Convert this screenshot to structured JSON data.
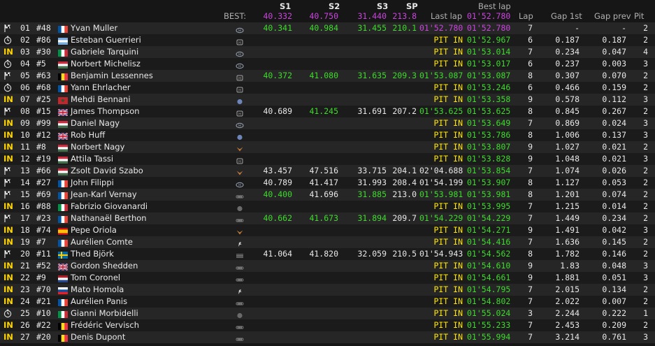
{
  "colors": {
    "background": "#161616",
    "row_odd": "#262626",
    "row_even": "#1b1b1b",
    "green": "#3ddc2a",
    "purple": "#cc44e0",
    "yellow": "#ffe600",
    "in_status": "#ffd400"
  },
  "header": {
    "best_label": "BEST:",
    "s1": "S1",
    "s2": "S2",
    "s3": "S3",
    "sp": "SP",
    "best_lap_label": "Best lap",
    "best_s1": "40.332",
    "best_s2": "40.750",
    "best_s3": "31.440",
    "best_sp": "213.8",
    "best_lap": "01'52.780",
    "last_lap": "Last lap",
    "lap": "Lap",
    "gap_1st": "Gap 1st",
    "gap_prev": "Gap prev",
    "pit": "Pit"
  },
  "rows": [
    {
      "status": "flag",
      "pos": "01",
      "num": "#48",
      "flag": "fr",
      "driver": "Yvan Muller",
      "car": "hyundai",
      "s1": "40.341",
      "s1c": "green",
      "s2": "40.984",
      "s2c": "green",
      "s3": "31.455",
      "s3c": "green",
      "sp": "210.1",
      "spc": "green",
      "last": "01'52.780",
      "lastc": "purple",
      "best": "01'52.780",
      "bestc": "purple",
      "lap": "7",
      "gap1": "-",
      "gapp": "-",
      "pit": "2"
    },
    {
      "status": "clock",
      "pos": "02",
      "num": "#86",
      "flag": "ar",
      "driver": "Esteban Guerrieri",
      "car": "honda",
      "s1": "",
      "s1c": "",
      "s2": "",
      "s2c": "",
      "s3": "",
      "s3c": "",
      "sp": "",
      "spc": "",
      "last": "PIT IN",
      "lastc": "yellow",
      "best": "01'52.967",
      "bestc": "green",
      "lap": "6",
      "gap1": "0.187",
      "gapp": "0.187",
      "pit": "2"
    },
    {
      "status": "IN",
      "pos": "03",
      "num": "#30",
      "flag": "it",
      "driver": "Gabriele Tarquini",
      "car": "hyundai",
      "s1": "",
      "s1c": "",
      "s2": "",
      "s2c": "",
      "s3": "",
      "s3c": "",
      "sp": "",
      "spc": "",
      "last": "PIT IN",
      "lastc": "yellow",
      "best": "01'53.014",
      "bestc": "green",
      "lap": "7",
      "gap1": "0.234",
      "gapp": "0.047",
      "pit": "4"
    },
    {
      "status": "clock",
      "pos": "04",
      "num": "#5",
      "flag": "hu",
      "driver": "Norbert Michelisz",
      "car": "hyundai",
      "s1": "",
      "s1c": "",
      "s2": "",
      "s2c": "",
      "s3": "",
      "s3c": "",
      "sp": "",
      "spc": "",
      "last": "PIT IN",
      "lastc": "yellow",
      "best": "01'53.017",
      "bestc": "green",
      "lap": "6",
      "gap1": "0.237",
      "gapp": "0.003",
      "pit": "3"
    },
    {
      "status": "flag",
      "pos": "05",
      "num": "#63",
      "flag": "be",
      "driver": "Benjamin Lessennes",
      "car": "honda",
      "s1": "40.372",
      "s1c": "green",
      "s2": "41.080",
      "s2c": "green",
      "s3": "31.635",
      "s3c": "green",
      "sp": "209.3",
      "spc": "green",
      "last": "01'53.087",
      "lastc": "green",
      "best": "01'53.087",
      "bestc": "green",
      "lap": "8",
      "gap1": "0.307",
      "gapp": "0.070",
      "pit": "2"
    },
    {
      "status": "clock",
      "pos": "06",
      "num": "#68",
      "flag": "fr",
      "driver": "Yann Ehrlacher",
      "car": "honda",
      "s1": "",
      "s1c": "",
      "s2": "",
      "s2c": "",
      "s3": "",
      "s3c": "",
      "sp": "",
      "spc": "",
      "last": "PIT IN",
      "lastc": "yellow",
      "best": "01'53.246",
      "bestc": "green",
      "lap": "6",
      "gap1": "0.466",
      "gapp": "0.159",
      "pit": "2"
    },
    {
      "status": "IN",
      "pos": "07",
      "num": "#25",
      "flag": "ma",
      "driver": "Mehdi Bennani",
      "car": "vw",
      "s1": "",
      "s1c": "",
      "s2": "",
      "s2c": "",
      "s3": "",
      "s3c": "",
      "sp": "",
      "spc": "",
      "last": "PIT IN",
      "lastc": "yellow",
      "best": "01'53.358",
      "bestc": "green",
      "lap": "9",
      "gap1": "0.578",
      "gapp": "0.112",
      "pit": "3"
    },
    {
      "status": "flag",
      "pos": "08",
      "num": "#15",
      "flag": "gb",
      "driver": "James Thompson",
      "car": "honda",
      "s1": "40.689",
      "s1c": "white",
      "s2": "41.245",
      "s2c": "green",
      "s3": "31.691",
      "s3c": "white",
      "sp": "207.2",
      "spc": "white",
      "last": "01'53.625",
      "lastc": "green",
      "best": "01'53.625",
      "bestc": "green",
      "lap": "8",
      "gap1": "0.845",
      "gapp": "0.267",
      "pit": "2"
    },
    {
      "status": "IN",
      "pos": "09",
      "num": "#99",
      "flag": "hu",
      "driver": "Daniel Nagy",
      "car": "hyundai",
      "s1": "",
      "s1c": "",
      "s2": "",
      "s2c": "",
      "s3": "",
      "s3c": "",
      "sp": "",
      "spc": "",
      "last": "PIT IN",
      "lastc": "yellow",
      "best": "01'53.649",
      "bestc": "green",
      "lap": "7",
      "gap1": "0.869",
      "gapp": "0.024",
      "pit": "3"
    },
    {
      "status": "IN",
      "pos": "10",
      "num": "#12",
      "flag": "gb",
      "driver": "Rob Huff",
      "car": "vw",
      "s1": "",
      "s1c": "",
      "s2": "",
      "s2c": "",
      "s3": "",
      "s3c": "",
      "sp": "",
      "spc": "",
      "last": "PIT IN",
      "lastc": "yellow",
      "best": "01'53.786",
      "bestc": "green",
      "lap": "8",
      "gap1": "1.006",
      "gapp": "0.137",
      "pit": "3"
    },
    {
      "status": "IN",
      "pos": "11",
      "num": "#8",
      "flag": "hu",
      "driver": "Norbert Nagy",
      "car": "cupra",
      "s1": "",
      "s1c": "",
      "s2": "",
      "s2c": "",
      "s3": "",
      "s3c": "",
      "sp": "",
      "spc": "",
      "last": "PIT IN",
      "lastc": "yellow",
      "best": "01'53.807",
      "bestc": "green",
      "lap": "9",
      "gap1": "1.027",
      "gapp": "0.021",
      "pit": "2"
    },
    {
      "status": "IN",
      "pos": "12",
      "num": "#19",
      "flag": "hu",
      "driver": "Attila Tassi",
      "car": "honda",
      "s1": "",
      "s1c": "",
      "s2": "",
      "s2c": "",
      "s3": "",
      "s3c": "",
      "sp": "",
      "spc": "",
      "last": "PIT IN",
      "lastc": "yellow",
      "best": "01'53.828",
      "bestc": "green",
      "lap": "9",
      "gap1": "1.048",
      "gapp": "0.021",
      "pit": "3"
    },
    {
      "status": "flag",
      "pos": "13",
      "num": "#66",
      "flag": "hu",
      "driver": "Zsolt David Szabo",
      "car": "cupra",
      "s1": "43.457",
      "s1c": "white",
      "s2": "47.516",
      "s2c": "white",
      "s3": "33.715",
      "s3c": "white",
      "sp": "204.1",
      "spc": "white",
      "last": "02'04.688",
      "lastc": "white",
      "best": "01'53.854",
      "bestc": "green",
      "lap": "7",
      "gap1": "1.074",
      "gapp": "0.026",
      "pit": "2"
    },
    {
      "status": "flag",
      "pos": "14",
      "num": "#27",
      "flag": "fr",
      "driver": "John Filippi",
      "car": "hyundai",
      "s1": "40.789",
      "s1c": "white",
      "s2": "41.417",
      "s2c": "white",
      "s3": "31.993",
      "s3c": "white",
      "sp": "208.4",
      "spc": "white",
      "last": "01'54.199",
      "lastc": "white",
      "best": "01'53.907",
      "bestc": "green",
      "lap": "8",
      "gap1": "1.127",
      "gapp": "0.053",
      "pit": "2"
    },
    {
      "status": "flag",
      "pos": "15",
      "num": "#69",
      "flag": "fr",
      "driver": "Jean-Karl Vernay",
      "car": "audi",
      "s1": "40.400",
      "s1c": "green",
      "s2": "41.696",
      "s2c": "white",
      "s3": "31.885",
      "s3c": "green",
      "sp": "213.0",
      "spc": "white",
      "last": "01'53.981",
      "lastc": "green",
      "best": "01'53.981",
      "bestc": "green",
      "lap": "8",
      "gap1": "1.201",
      "gapp": "0.074",
      "pit": "2"
    },
    {
      "status": "IN",
      "pos": "16",
      "num": "#88",
      "flag": "it",
      "driver": "Fabrizio Giovanardi",
      "car": "alfa",
      "s1": "",
      "s1c": "",
      "s2": "",
      "s2c": "",
      "s3": "",
      "s3c": "",
      "sp": "",
      "spc": "",
      "last": "PIT IN",
      "lastc": "yellow",
      "best": "01'53.995",
      "bestc": "green",
      "lap": "7",
      "gap1": "1.215",
      "gapp": "0.014",
      "pit": "2"
    },
    {
      "status": "flag",
      "pos": "17",
      "num": "#23",
      "flag": "fr",
      "driver": "Nathanaël Berthon",
      "car": "audi",
      "s1": "40.662",
      "s1c": "green",
      "s2": "41.673",
      "s2c": "green",
      "s3": "31.894",
      "s3c": "green",
      "sp": "209.7",
      "spc": "white",
      "last": "01'54.229",
      "lastc": "green",
      "best": "01'54.229",
      "bestc": "green",
      "lap": "7",
      "gap1": "1.449",
      "gapp": "0.234",
      "pit": "2"
    },
    {
      "status": "IN",
      "pos": "18",
      "num": "#74",
      "flag": "es",
      "driver": "Pepe Oriola",
      "car": "cupra",
      "s1": "",
      "s1c": "",
      "s2": "",
      "s2c": "",
      "s3": "",
      "s3c": "",
      "sp": "",
      "spc": "",
      "last": "PIT IN",
      "lastc": "yellow",
      "best": "01'54.271",
      "bestc": "green",
      "lap": "9",
      "gap1": "1.491",
      "gapp": "0.042",
      "pit": "3"
    },
    {
      "status": "IN",
      "pos": "19",
      "num": "#7",
      "flag": "fr",
      "driver": "Aurélien Comte",
      "car": "peugeot",
      "s1": "",
      "s1c": "",
      "s2": "",
      "s2c": "",
      "s3": "",
      "s3c": "",
      "sp": "",
      "spc": "",
      "last": "PIT IN",
      "lastc": "yellow",
      "best": "01'54.416",
      "bestc": "green",
      "lap": "7",
      "gap1": "1.636",
      "gapp": "0.145",
      "pit": "2"
    },
    {
      "status": "flag",
      "pos": "20",
      "num": "#11",
      "flag": "se",
      "driver": "Thed Björk",
      "car": "lynk",
      "s1": "41.064",
      "s1c": "white",
      "s2": "41.820",
      "s2c": "white",
      "s3": "32.059",
      "s3c": "white",
      "sp": "210.5",
      "spc": "white",
      "last": "01'54.943",
      "lastc": "white",
      "best": "01'54.562",
      "bestc": "green",
      "lap": "8",
      "gap1": "1.782",
      "gapp": "0.146",
      "pit": "2"
    },
    {
      "status": "IN",
      "pos": "21",
      "num": "#52",
      "flag": "gb",
      "driver": "Gordon Shedden",
      "car": "audi",
      "s1": "",
      "s1c": "",
      "s2": "",
      "s2c": "",
      "s3": "",
      "s3c": "",
      "sp": "",
      "spc": "",
      "last": "PIT IN",
      "lastc": "yellow",
      "best": "01'54.610",
      "bestc": "green",
      "lap": "9",
      "gap1": "1.83",
      "gapp": "0.048",
      "pit": "3"
    },
    {
      "status": "IN",
      "pos": "22",
      "num": "#9",
      "flag": "nl",
      "driver": "Tom Coronel",
      "car": "audi",
      "s1": "",
      "s1c": "",
      "s2": "",
      "s2c": "",
      "s3": "",
      "s3c": "",
      "sp": "",
      "spc": "",
      "last": "PIT IN",
      "lastc": "yellow",
      "best": "01'54.661",
      "bestc": "green",
      "lap": "9",
      "gap1": "1.881",
      "gapp": "0.051",
      "pit": "3"
    },
    {
      "status": "IN",
      "pos": "23",
      "num": "#70",
      "flag": "sk",
      "driver": "Mato Homola",
      "car": "peugeot",
      "s1": "",
      "s1c": "",
      "s2": "",
      "s2c": "",
      "s3": "",
      "s3c": "",
      "sp": "",
      "spc": "",
      "last": "PIT IN",
      "lastc": "yellow",
      "best": "01'54.795",
      "bestc": "green",
      "lap": "7",
      "gap1": "2.015",
      "gapp": "0.134",
      "pit": "2"
    },
    {
      "status": "IN",
      "pos": "24",
      "num": "#21",
      "flag": "fr",
      "driver": "Aurélien Panis",
      "car": "audi",
      "s1": "",
      "s1c": "",
      "s2": "",
      "s2c": "",
      "s3": "",
      "s3c": "",
      "sp": "",
      "spc": "",
      "last": "PIT IN",
      "lastc": "yellow",
      "best": "01'54.802",
      "bestc": "green",
      "lap": "7",
      "gap1": "2.022",
      "gapp": "0.007",
      "pit": "2"
    },
    {
      "status": "clock",
      "pos": "25",
      "num": "#10",
      "flag": "it",
      "driver": "Gianni Morbidelli",
      "car": "alfa",
      "s1": "",
      "s1c": "",
      "s2": "",
      "s2c": "",
      "s3": "",
      "s3c": "",
      "sp": "",
      "spc": "",
      "last": "PIT IN",
      "lastc": "yellow",
      "best": "01'55.024",
      "bestc": "green",
      "lap": "3",
      "gap1": "2.244",
      "gapp": "0.222",
      "pit": "1"
    },
    {
      "status": "IN",
      "pos": "26",
      "num": "#22",
      "flag": "be",
      "driver": "Frédéric Vervisch",
      "car": "audi",
      "s1": "",
      "s1c": "",
      "s2": "",
      "s2c": "",
      "s3": "",
      "s3c": "",
      "sp": "",
      "spc": "",
      "last": "PIT IN",
      "lastc": "yellow",
      "best": "01'55.233",
      "bestc": "green",
      "lap": "7",
      "gap1": "2.453",
      "gapp": "0.209",
      "pit": "2"
    },
    {
      "status": "IN",
      "pos": "27",
      "num": "#20",
      "flag": "be",
      "driver": "Denis Dupont",
      "car": "audi",
      "s1": "",
      "s1c": "",
      "s2": "",
      "s2c": "",
      "s3": "",
      "s3c": "",
      "sp": "",
      "spc": "",
      "last": "PIT IN",
      "lastc": "yellow",
      "best": "01'55.994",
      "bestc": "green",
      "lap": "7",
      "gap1": "3.214",
      "gapp": "0.761",
      "pit": "3"
    }
  ]
}
